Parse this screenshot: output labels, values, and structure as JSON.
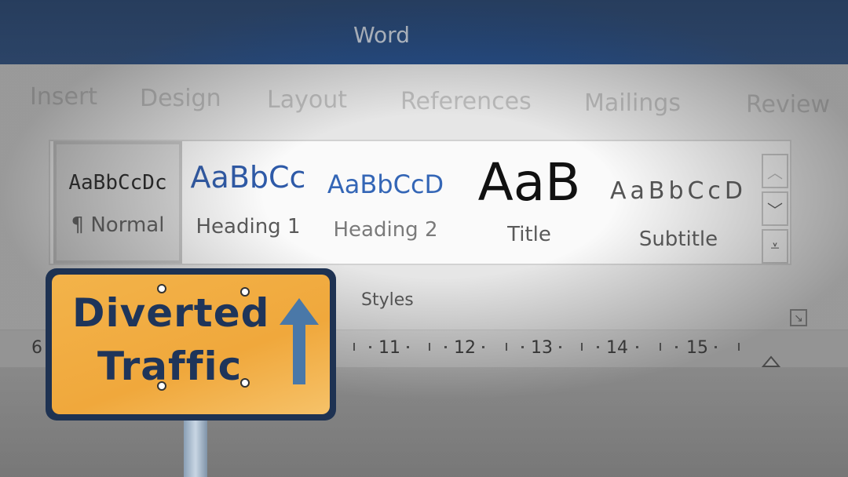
{
  "window": {
    "title": "Word"
  },
  "tabs": [
    "Insert",
    "Design",
    "Layout",
    "References",
    "Mailings",
    "Review"
  ],
  "styles_group": {
    "label": "Styles",
    "items": [
      {
        "sample": "AaBbCcDc",
        "label": "¶ Normal",
        "selected": true
      },
      {
        "sample": "AaBbCc",
        "label": "Heading 1",
        "selected": false
      },
      {
        "sample": "AaBbCcD",
        "label": "Heading 2",
        "selected": false
      },
      {
        "sample": "AaB",
        "label": "Title",
        "selected": false
      },
      {
        "sample": "AaBbCcD",
        "label": "Subtitle",
        "selected": false
      }
    ]
  },
  "ruler": {
    "numbers": [
      "6",
      "11",
      "12",
      "13",
      "14",
      "15"
    ]
  },
  "sign": {
    "line1": "Diverted",
    "line2": "Traffic",
    "colors": {
      "face": "#f0a83c",
      "text": "#1f355a",
      "border": "#1e3252"
    }
  },
  "icons": {
    "scroll_up": "chevron-up-icon",
    "scroll_down": "chevron-down-icon",
    "more": "expand-gallery-icon",
    "launcher": "dialog-launcher-icon",
    "arrow": "arrow-up-icon"
  },
  "colors": {
    "titlebar": "#163e78",
    "ribbon": "#e6e6e6",
    "accent_heading": "#2e5aa8"
  }
}
